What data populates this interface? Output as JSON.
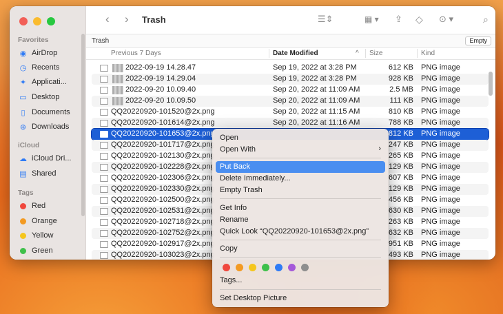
{
  "window": {
    "title": "Trash",
    "path_label": "Trash",
    "empty_button": "Empty",
    "traffic": [
      "#f25f57",
      "#fabb2e",
      "#28c840"
    ],
    "accent": "#1d5fd6"
  },
  "toolbar": {
    "back_icon": "chevron-left-icon",
    "forward_icon": "chevron-right-icon",
    "list_view_icon": "list-view-icon",
    "grid_view_icon": "grid-view-icon",
    "share_icon": "share-icon",
    "tag_icon": "tag-icon",
    "more_icon": "more-icon",
    "search_icon": "search-icon"
  },
  "sidebar": {
    "favorites_label": "Favorites",
    "favorites": [
      {
        "label": "AirDrop",
        "icon": "airdrop-icon"
      },
      {
        "label": "Recents",
        "icon": "clock-icon"
      },
      {
        "label": "Applicati...",
        "icon": "applications-icon"
      },
      {
        "label": "Desktop",
        "icon": "desktop-icon"
      },
      {
        "label": "Documents",
        "icon": "document-icon"
      },
      {
        "label": "Downloads",
        "icon": "download-icon"
      }
    ],
    "icloud_label": "iCloud",
    "icloud": [
      {
        "label": "iCloud Dri...",
        "icon": "cloud-icon"
      },
      {
        "label": "Shared",
        "icon": "shared-folder-icon"
      }
    ],
    "tags_label": "Tags",
    "tags": [
      {
        "label": "Red",
        "color": "#f0473c"
      },
      {
        "label": "Orange",
        "color": "#f39a22"
      },
      {
        "label": "Yellow",
        "color": "#f5c61c"
      },
      {
        "label": "Green",
        "color": "#3ec04a"
      }
    ]
  },
  "columns": {
    "group": "Previous 7 Days",
    "date": "Date Modified",
    "size": "Size",
    "kind": "Kind"
  },
  "files": [
    {
      "name": "2022-09-19 14.28.47",
      "date": "Sep 19, 2022 at 3:28 PM",
      "size": "612 KB",
      "kind": "PNG image"
    },
    {
      "name": "2022-09-19 14.29.04",
      "date": "Sep 19, 2022 at 3:28 PM",
      "size": "928 KB",
      "kind": "PNG image"
    },
    {
      "name": "2022-09-20 10.09.40",
      "date": "Sep 20, 2022 at 11:09 AM",
      "size": "2.5 MB",
      "kind": "PNG image"
    },
    {
      "name": "2022-09-20 10.09.50",
      "date": "Sep 20, 2022 at 11:09 AM",
      "size": "111 KB",
      "kind": "PNG image"
    },
    {
      "name": "QQ20220920-101520@2x.png",
      "date": "Sep 20, 2022 at 11:15 AM",
      "size": "810 KB",
      "kind": "PNG image"
    },
    {
      "name": "QQ20220920-101614@2x.png",
      "date": "Sep 20, 2022 at 11:16 AM",
      "size": "788 KB",
      "kind": "PNG image"
    },
    {
      "name": "QQ20220920-101653@2x.png",
      "date": "",
      "size": "812 KB",
      "kind": "PNG image"
    },
    {
      "name": "QQ20220920-101717@2x.png",
      "date": "",
      "size": "247 KB",
      "kind": "PNG image"
    },
    {
      "name": "QQ20220920-102130@2x.png",
      "date": "",
      "size": "265 KB",
      "kind": "PNG image"
    },
    {
      "name": "QQ20220920-102228@2x.png",
      "date": "",
      "size": "129 KB",
      "kind": "PNG image"
    },
    {
      "name": "QQ20220920-102306@2x.png",
      "date": "",
      "size": "607 KB",
      "kind": "PNG image"
    },
    {
      "name": "QQ20220920-102330@2x.png",
      "date": "",
      "size": "129 KB",
      "kind": "PNG image"
    },
    {
      "name": "QQ20220920-102500@2x.png",
      "date": "",
      "size": "456 KB",
      "kind": "PNG image"
    },
    {
      "name": "QQ20220920-102531@2x.png",
      "date": "",
      "size": "630 KB",
      "kind": "PNG image"
    },
    {
      "name": "QQ20220920-102718@2x.png",
      "date": "",
      "size": "263 KB",
      "kind": "PNG image"
    },
    {
      "name": "QQ20220920-102752@2x.png",
      "date": "",
      "size": "632 KB",
      "kind": "PNG image"
    },
    {
      "name": "QQ20220920-102917@2x.png",
      "date": "",
      "size": "951 KB",
      "kind": "PNG image"
    },
    {
      "name": "QQ20220920-103023@2x.png",
      "date": "",
      "size": "493 KB",
      "kind": "PNG image"
    }
  ],
  "context_menu": {
    "open": "Open",
    "open_with": "Open With",
    "put_back": "Put Back",
    "delete_immediately": "Delete Immediately...",
    "empty_trash": "Empty Trash",
    "get_info": "Get Info",
    "rename": "Rename",
    "quick_look": "Quick Look “QQ20220920-101653@2x.png”",
    "copy": "Copy",
    "tag_colors": [
      "#f0473c",
      "#f39a22",
      "#f5c61c",
      "#3ec04a",
      "#2f7bf5",
      "#a559d9",
      "#8e8e8e"
    ],
    "tags": "Tags...",
    "set_desktop": "Set Desktop Picture"
  }
}
